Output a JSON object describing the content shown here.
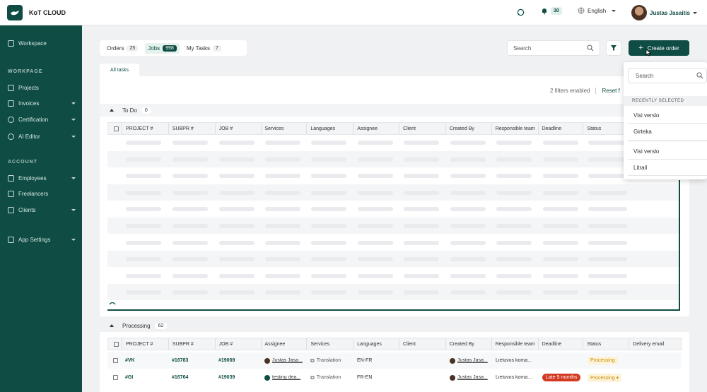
{
  "app": {
    "name": "KoT CLOUD"
  },
  "topbar": {
    "notifications_count": "30",
    "language": "English",
    "user_name": "Justas Jasaitis"
  },
  "sidebar": {
    "workspace": "Workspace",
    "workpage_heading": "WORKPAGE",
    "workpage_items": [
      "Projects",
      "Invoices",
      "Certification",
      "AI Editor"
    ],
    "account_heading": "ACCOUNT",
    "account_items": [
      "Employees",
      "Freelancers",
      "Clients"
    ],
    "app_settings": "App Settings"
  },
  "tabs": [
    {
      "label": "Orders",
      "count": "25"
    },
    {
      "label": "Jobs",
      "count": "998"
    },
    {
      "label": "My Tasks",
      "count": "7"
    }
  ],
  "search": {
    "placeholder": "Search"
  },
  "create_order": "Create order",
  "subtab": "All tasks",
  "filters_enabled": "2 filters enabled",
  "reset": "Reset f",
  "groups": {
    "todo": {
      "label": "To Do",
      "count": "0"
    },
    "processing": {
      "label": "Processing",
      "count": "62"
    }
  },
  "todo_columns": [
    "PROJECT #",
    "SUBPR #",
    "JOB #",
    "Services",
    "Languages",
    "Assignee",
    "Client",
    "Created By",
    "Responsible team",
    "Deadline",
    "Status"
  ],
  "processing_columns": [
    "PROJECT #",
    "SUBPR #",
    "JOB #",
    "Assignee",
    "Services",
    "Languages",
    "Client",
    "Created By",
    "Responsible team",
    "Deadline",
    "Status",
    "Delivery email"
  ],
  "rows": [
    {
      "project": "#VK",
      "subpr": "#16783",
      "job": "#19069",
      "assignee": "Justas Jasa...",
      "service": "Translation",
      "languages": "EN-FR",
      "client": "",
      "created_by": "Justas Jasa...",
      "team": "Lietuvos koma...",
      "deadline": "",
      "status": "Processing"
    },
    {
      "project": "#GI",
      "subpr": "#16764",
      "job": "#19039",
      "assignee": "testing dea...",
      "service": "Translation",
      "languages": "FR-EN",
      "client": "",
      "created_by": "Justas Jasa...",
      "team": "Lietuvos koma...",
      "deadline": "Late 5 months",
      "status": "Processing"
    }
  ],
  "dropdown": {
    "search_placeholder": "Search",
    "recent_heading": "RECENTLY SELECTED",
    "recent": [
      "Visi verslo",
      "Girteka"
    ],
    "others": [
      "Visi verslo",
      "Litrail"
    ]
  },
  "colors": {
    "brand": "#0f4d44",
    "late": "#d23a22",
    "processing": "#c98a00"
  }
}
